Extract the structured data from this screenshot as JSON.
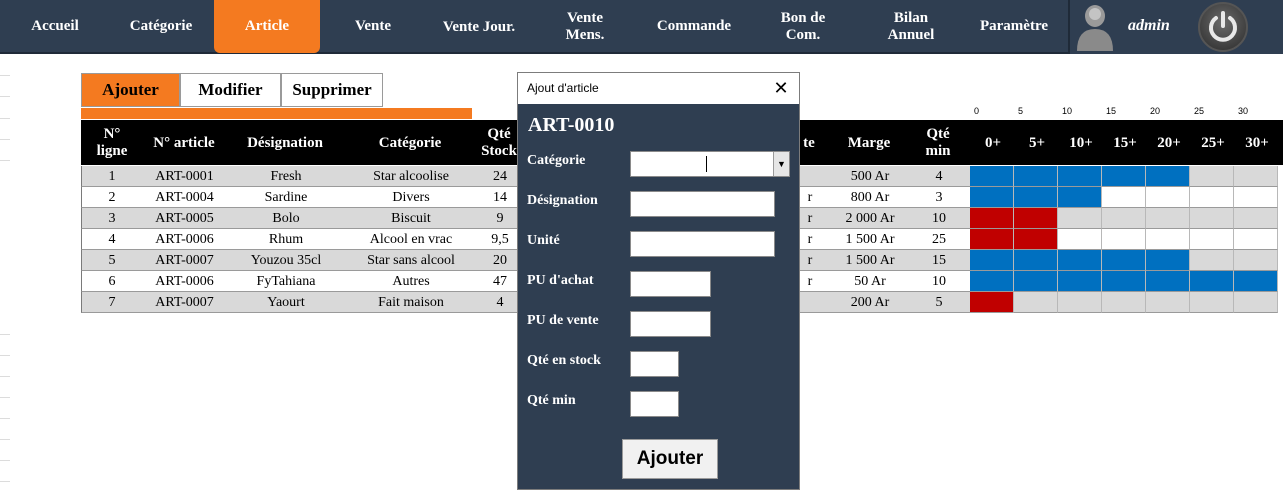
{
  "nav": {
    "items": [
      {
        "label": "Accueil"
      },
      {
        "label": "Catégorie"
      },
      {
        "label": "Article"
      },
      {
        "label": "Vente"
      },
      {
        "label": "Vente Jour."
      },
      {
        "label": "Vente Mens."
      },
      {
        "label": "Commande"
      },
      {
        "label": "Bon de Com."
      },
      {
        "label": "Bilan Annuel"
      },
      {
        "label": "Paramètre"
      }
    ],
    "active": "Article",
    "user": "admin"
  },
  "tabs": [
    "Ajouter",
    "Modifier",
    "Supprimer"
  ],
  "table": {
    "headers": {
      "num": "N° ligne",
      "article": "N° article",
      "designation": "Désignation",
      "categorie": "Catégorie",
      "stock": "Qté Stock",
      "te": "te",
      "marge": "Marge",
      "qtemin": "Qté min"
    },
    "gauge_headers": [
      "0+",
      "5+",
      "10+",
      "15+",
      "20+",
      "25+",
      "30+"
    ],
    "gauge_ticks": [
      "0",
      "5",
      "10",
      "15",
      "20",
      "25",
      "30"
    ],
    "rows": [
      {
        "num": "1",
        "article": "ART-0001",
        "designation": "Fresh",
        "categorie": "Star alcoolise",
        "stock": "24",
        "te": "",
        "marge": "500 Ar",
        "qtemin": "4",
        "gauge": [
          "blue",
          "blue",
          "blue",
          "blue",
          "blue",
          "",
          ""
        ]
      },
      {
        "num": "2",
        "article": "ART-0004",
        "designation": "Sardine",
        "categorie": "Divers",
        "stock": "14",
        "te": "r",
        "marge": "800 Ar",
        "qtemin": "3",
        "gauge": [
          "blue",
          "blue",
          "blue",
          "",
          "",
          "",
          ""
        ]
      },
      {
        "num": "3",
        "article": "ART-0005",
        "designation": "Bolo",
        "categorie": "Biscuit",
        "stock": "9",
        "te": "r",
        "marge": "2 000 Ar",
        "qtemin": "10",
        "gauge": [
          "red",
          "red",
          "",
          "",
          "",
          "",
          ""
        ]
      },
      {
        "num": "4",
        "article": "ART-0006",
        "designation": "Rhum",
        "categorie": "Alcool en vrac",
        "stock": "9,5",
        "te": "r",
        "marge": "1 500 Ar",
        "qtemin": "25",
        "gauge": [
          "red",
          "red",
          "",
          "",
          "",
          "",
          ""
        ]
      },
      {
        "num": "5",
        "article": "ART-0007",
        "designation": "Youzou 35cl",
        "categorie": "Star sans alcool",
        "stock": "20",
        "te": "r",
        "marge": "1 500 Ar",
        "qtemin": "15",
        "gauge": [
          "blue",
          "blue",
          "blue",
          "blue",
          "blue",
          "",
          ""
        ]
      },
      {
        "num": "6",
        "article": "ART-0006",
        "designation": "FyTahiana",
        "categorie": "Autres",
        "stock": "47",
        "te": "r",
        "marge": "50 Ar",
        "qtemin": "10",
        "gauge": [
          "blue",
          "blue",
          "blue",
          "blue",
          "blue",
          "blue",
          "blue"
        ]
      },
      {
        "num": "7",
        "article": "ART-0007",
        "designation": "Yaourt",
        "categorie": "Fait maison",
        "stock": "4",
        "te": "",
        "marge": "200 Ar",
        "qtemin": "5",
        "gauge": [
          "red",
          "",
          "",
          "",
          "",
          "",
          ""
        ]
      }
    ]
  },
  "dialog": {
    "title": "Ajout d'article",
    "code": "ART-0010",
    "fields": [
      {
        "label": "Catégorie",
        "value": ""
      },
      {
        "label": "Désignation",
        "value": ""
      },
      {
        "label": "Unité",
        "value": ""
      },
      {
        "label": "PU d'achat",
        "value": ""
      },
      {
        "label": "PU de vente",
        "value": ""
      },
      {
        "label": "Qté en stock",
        "value": ""
      },
      {
        "label": "Qté min",
        "value": ""
      }
    ],
    "submit": "Ajouter"
  },
  "colors": {
    "nav_bg": "#2f3e51",
    "accent": "#f47a20",
    "gauge_blue": "#0070c0",
    "gauge_red": "#c00000",
    "gauge_empty": "#d9d9d9"
  }
}
